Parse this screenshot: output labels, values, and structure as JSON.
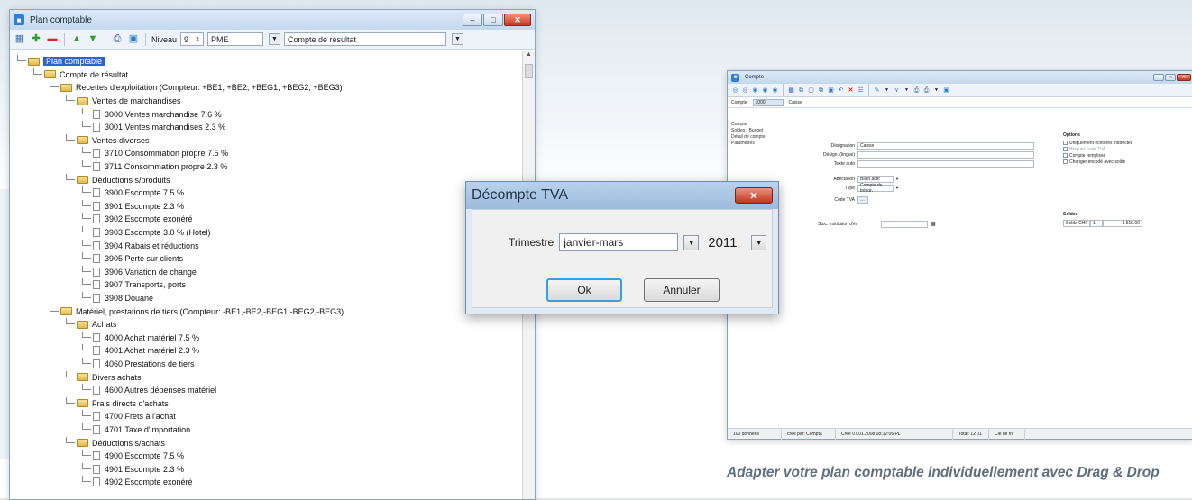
{
  "plan_window": {
    "title": "Plan comptable",
    "niveau_label": "Niveau",
    "niveau_value": "9",
    "company": "PME",
    "view": "Compte de résultat",
    "tree": [
      {
        "level": 0,
        "type": "folder",
        "label": "Plan comptable",
        "selected": true
      },
      {
        "level": 1,
        "type": "folder",
        "label": "Compte de résultat"
      },
      {
        "level": 2,
        "type": "folder",
        "label": "Recettes d'exploitation  (Compteur: +BE1, +BE2, +BEG1, +BEG2, +BEG3)"
      },
      {
        "level": 3,
        "type": "folder",
        "label": "Ventes de marchandises"
      },
      {
        "level": 4,
        "type": "doc",
        "label": "3000 Ventes marchandise 7.6 %"
      },
      {
        "level": 4,
        "type": "doc",
        "label": "3001 Ventes marchandises 2.3 %"
      },
      {
        "level": 3,
        "type": "folder",
        "label": "Ventes diverses"
      },
      {
        "level": 4,
        "type": "doc",
        "label": "3710 Consommation propre 7.5 %"
      },
      {
        "level": 4,
        "type": "doc",
        "label": "3711 Consommation propre 2.3 %"
      },
      {
        "level": 3,
        "type": "folder",
        "label": "Déductions s/produits"
      },
      {
        "level": 4,
        "type": "doc",
        "label": "3900 Escompte 7.5 %"
      },
      {
        "level": 4,
        "type": "doc",
        "label": "3901 Escompte 2.3 %"
      },
      {
        "level": 4,
        "type": "doc",
        "label": "3902 Escompte exonéré"
      },
      {
        "level": 4,
        "type": "doc",
        "label": "3903 Escompte 3.0 % (Hotel)"
      },
      {
        "level": 4,
        "type": "doc",
        "label": "3904 Rabais et réductions"
      },
      {
        "level": 4,
        "type": "doc",
        "label": "3905 Perte sur clients"
      },
      {
        "level": 4,
        "type": "doc",
        "label": "3906 Variation de change"
      },
      {
        "level": 4,
        "type": "doc",
        "label": "3907 Transports, ports"
      },
      {
        "level": 4,
        "type": "doc",
        "label": "3908 Douane"
      },
      {
        "level": 2,
        "type": "folder",
        "label": "Matériel, prestations de tiers  (Compteur: -BE1,-BE2,-BEG1,-BEG2,-BEG3)"
      },
      {
        "level": 3,
        "type": "folder",
        "label": "Achats"
      },
      {
        "level": 4,
        "type": "doc",
        "label": "4000 Achat matériel 7.5 %"
      },
      {
        "level": 4,
        "type": "doc",
        "label": "4001 Achat matériel 2.3 %"
      },
      {
        "level": 4,
        "type": "doc",
        "label": "4060 Prestations de tiers"
      },
      {
        "level": 3,
        "type": "folder",
        "label": "Divers achats"
      },
      {
        "level": 4,
        "type": "doc",
        "label": "4600 Autres dépenses matériel"
      },
      {
        "level": 3,
        "type": "folder",
        "label": "Frais directs d'achats"
      },
      {
        "level": 4,
        "type": "doc",
        "label": "4700 Frets à l'achat"
      },
      {
        "level": 4,
        "type": "doc",
        "label": "4701 Taxe d'importation"
      },
      {
        "level": 3,
        "type": "folder",
        "label": "Déductions s/achats"
      },
      {
        "level": 4,
        "type": "doc",
        "label": "4900 Escompte 7.5 %"
      },
      {
        "level": 4,
        "type": "doc",
        "label": "4901 Escompte 2.3 %"
      },
      {
        "level": 4,
        "type": "doc",
        "label": "4902 Escompte exonéré"
      }
    ]
  },
  "dialog": {
    "title": "Décompte TVA",
    "close_glyph": "✕",
    "trimestre_label": "Trimestre",
    "trimestre_value": "janvier-mars",
    "year_value": "2011",
    "ok_label": "Ok",
    "cancel_label": "Annuler"
  },
  "compte_window": {
    "title": "Compte",
    "compte_label": "Compte",
    "compte_value": "1000",
    "compte_name": "Caisse",
    "side_items": [
      "Compte",
      "Soldes / Budget",
      "Détail de compte",
      "Paramètres"
    ],
    "form": {
      "designation_label": "Désignation",
      "designation_value": "Caisse",
      "design_lingue_label": "Désign. (lingue)",
      "texte_auto_label": "Texte auto",
      "affectation_label": "Affectation",
      "affectation_value": "Bilan actif",
      "type_label": "Type",
      "type_value": "Compte de trésor.",
      "code_tva_label": "Code TVA",
      "stock_label": "Stoc. institution d'éc"
    },
    "options_title": "Options",
    "options": [
      {
        "label": "Uniquement écritures indirectes",
        "disabled": false
      },
      {
        "label": "Bloquer code TVA",
        "disabled": true
      },
      {
        "label": "Compte remplissé",
        "disabled": false
      },
      {
        "label": "Changer encodé avec solde",
        "disabled": false
      }
    ],
    "soldes_title": "Soldes",
    "soldes_row": [
      "Solde CHF",
      "1",
      "3.515.00"
    ],
    "status": [
      "100 données",
      "créé par: Compta",
      "Créé 07.01.2008 08:12:06 PL",
      "Total: 12 01",
      "Clé de tri"
    ]
  },
  "caption": "Adapter votre plan comptable individuellement avec Drag & Drop"
}
